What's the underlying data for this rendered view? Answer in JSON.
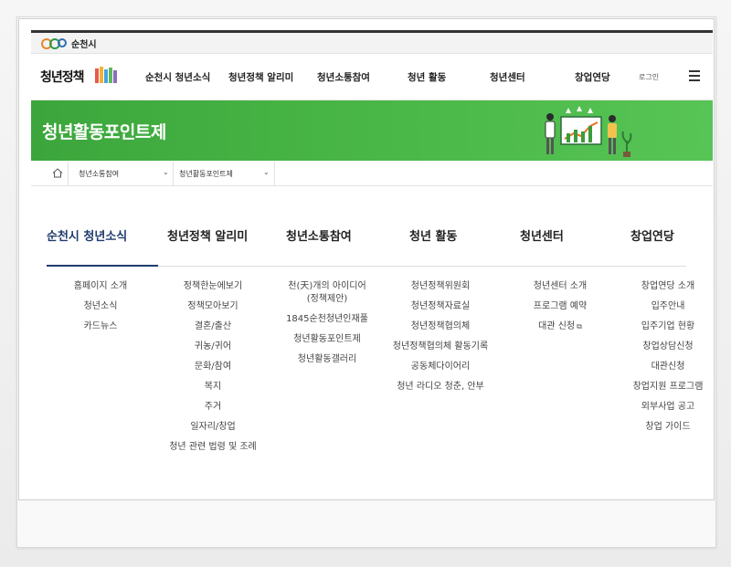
{
  "brand": {
    "name": "순천시"
  },
  "site": {
    "logo_text": "청년정책",
    "login": "로그인"
  },
  "nav": {
    "items": [
      "순천시 청년소식",
      "청년정책 알리미",
      "청년소통참여",
      "청년 활동",
      "청년센터",
      "창업연당"
    ]
  },
  "banner": {
    "title": "청년활동포인트제"
  },
  "breadcrumb": {
    "level1": "청년소통참여",
    "level2": "청년활동포인트제"
  },
  "menu": {
    "columns": [
      {
        "heading": "순천시 청년소식",
        "items": [
          "홈페이지 소개",
          "청년소식",
          "카드뉴스"
        ]
      },
      {
        "heading": "청년정책 알리미",
        "items": [
          "정책한눈에보기",
          "정책모아보기",
          "결혼/출산",
          "귀농/귀어",
          "문화/참여",
          "복지",
          "주거",
          "일자리/창업",
          "청년 관련 법령 및 조례"
        ]
      },
      {
        "heading": "청년소통참여",
        "items": [
          "천(天)개의 아이디어 (정책제안)",
          "1845순천청년인재풀",
          "청년활동포인트제",
          "청년활동갤러리"
        ]
      },
      {
        "heading": "청년 활동",
        "items": [
          "청년정책위원회",
          "청년정책자료실",
          "청년정책협의체",
          "청년정책협의체 활동기록",
          "공동체다이어리",
          "청년 라디오 청춘, 안부"
        ]
      },
      {
        "heading": "청년센터",
        "items": [
          "청년센터 소개",
          "프로그램 예약",
          "대관 신청"
        ]
      },
      {
        "heading": "창업연당",
        "items": [
          "창업연당 소개",
          "입주안내",
          "입주기업 현황",
          "창업상담신청",
          "대관신청",
          "창업지원 프로그램",
          "외부사업 공고",
          "창업 가이드"
        ]
      }
    ]
  },
  "colors": {
    "accent_navy": "#1f3b6e",
    "banner_green": "#4ab848"
  },
  "icons": {
    "home": "home-icon",
    "menu": "hamburger-icon",
    "external": "external-link-icon",
    "dropdown": "chevron-down-icon"
  }
}
